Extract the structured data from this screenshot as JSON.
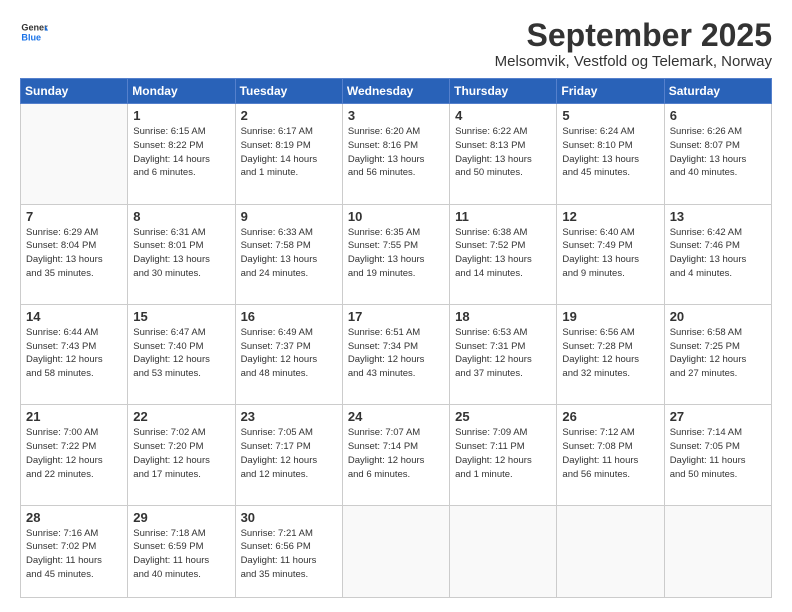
{
  "header": {
    "logo_line1": "General",
    "logo_line2": "Blue",
    "month": "September 2025",
    "location": "Melsomvik, Vestfold og Telemark, Norway"
  },
  "weekdays": [
    "Sunday",
    "Monday",
    "Tuesday",
    "Wednesday",
    "Thursday",
    "Friday",
    "Saturday"
  ],
  "weeks": [
    [
      {
        "day": "",
        "info": ""
      },
      {
        "day": "1",
        "info": "Sunrise: 6:15 AM\nSunset: 8:22 PM\nDaylight: 14 hours\nand 6 minutes."
      },
      {
        "day": "2",
        "info": "Sunrise: 6:17 AM\nSunset: 8:19 PM\nDaylight: 14 hours\nand 1 minute."
      },
      {
        "day": "3",
        "info": "Sunrise: 6:20 AM\nSunset: 8:16 PM\nDaylight: 13 hours\nand 56 minutes."
      },
      {
        "day": "4",
        "info": "Sunrise: 6:22 AM\nSunset: 8:13 PM\nDaylight: 13 hours\nand 50 minutes."
      },
      {
        "day": "5",
        "info": "Sunrise: 6:24 AM\nSunset: 8:10 PM\nDaylight: 13 hours\nand 45 minutes."
      },
      {
        "day": "6",
        "info": "Sunrise: 6:26 AM\nSunset: 8:07 PM\nDaylight: 13 hours\nand 40 minutes."
      }
    ],
    [
      {
        "day": "7",
        "info": "Sunrise: 6:29 AM\nSunset: 8:04 PM\nDaylight: 13 hours\nand 35 minutes."
      },
      {
        "day": "8",
        "info": "Sunrise: 6:31 AM\nSunset: 8:01 PM\nDaylight: 13 hours\nand 30 minutes."
      },
      {
        "day": "9",
        "info": "Sunrise: 6:33 AM\nSunset: 7:58 PM\nDaylight: 13 hours\nand 24 minutes."
      },
      {
        "day": "10",
        "info": "Sunrise: 6:35 AM\nSunset: 7:55 PM\nDaylight: 13 hours\nand 19 minutes."
      },
      {
        "day": "11",
        "info": "Sunrise: 6:38 AM\nSunset: 7:52 PM\nDaylight: 13 hours\nand 14 minutes."
      },
      {
        "day": "12",
        "info": "Sunrise: 6:40 AM\nSunset: 7:49 PM\nDaylight: 13 hours\nand 9 minutes."
      },
      {
        "day": "13",
        "info": "Sunrise: 6:42 AM\nSunset: 7:46 PM\nDaylight: 13 hours\nand 4 minutes."
      }
    ],
    [
      {
        "day": "14",
        "info": "Sunrise: 6:44 AM\nSunset: 7:43 PM\nDaylight: 12 hours\nand 58 minutes."
      },
      {
        "day": "15",
        "info": "Sunrise: 6:47 AM\nSunset: 7:40 PM\nDaylight: 12 hours\nand 53 minutes."
      },
      {
        "day": "16",
        "info": "Sunrise: 6:49 AM\nSunset: 7:37 PM\nDaylight: 12 hours\nand 48 minutes."
      },
      {
        "day": "17",
        "info": "Sunrise: 6:51 AM\nSunset: 7:34 PM\nDaylight: 12 hours\nand 43 minutes."
      },
      {
        "day": "18",
        "info": "Sunrise: 6:53 AM\nSunset: 7:31 PM\nDaylight: 12 hours\nand 37 minutes."
      },
      {
        "day": "19",
        "info": "Sunrise: 6:56 AM\nSunset: 7:28 PM\nDaylight: 12 hours\nand 32 minutes."
      },
      {
        "day": "20",
        "info": "Sunrise: 6:58 AM\nSunset: 7:25 PM\nDaylight: 12 hours\nand 27 minutes."
      }
    ],
    [
      {
        "day": "21",
        "info": "Sunrise: 7:00 AM\nSunset: 7:22 PM\nDaylight: 12 hours\nand 22 minutes."
      },
      {
        "day": "22",
        "info": "Sunrise: 7:02 AM\nSunset: 7:20 PM\nDaylight: 12 hours\nand 17 minutes."
      },
      {
        "day": "23",
        "info": "Sunrise: 7:05 AM\nSunset: 7:17 PM\nDaylight: 12 hours\nand 12 minutes."
      },
      {
        "day": "24",
        "info": "Sunrise: 7:07 AM\nSunset: 7:14 PM\nDaylight: 12 hours\nand 6 minutes."
      },
      {
        "day": "25",
        "info": "Sunrise: 7:09 AM\nSunset: 7:11 PM\nDaylight: 12 hours\nand 1 minute."
      },
      {
        "day": "26",
        "info": "Sunrise: 7:12 AM\nSunset: 7:08 PM\nDaylight: 11 hours\nand 56 minutes."
      },
      {
        "day": "27",
        "info": "Sunrise: 7:14 AM\nSunset: 7:05 PM\nDaylight: 11 hours\nand 50 minutes."
      }
    ],
    [
      {
        "day": "28",
        "info": "Sunrise: 7:16 AM\nSunset: 7:02 PM\nDaylight: 11 hours\nand 45 minutes."
      },
      {
        "day": "29",
        "info": "Sunrise: 7:18 AM\nSunset: 6:59 PM\nDaylight: 11 hours\nand 40 minutes."
      },
      {
        "day": "30",
        "info": "Sunrise: 7:21 AM\nSunset: 6:56 PM\nDaylight: 11 hours\nand 35 minutes."
      },
      {
        "day": "",
        "info": ""
      },
      {
        "day": "",
        "info": ""
      },
      {
        "day": "",
        "info": ""
      },
      {
        "day": "",
        "info": ""
      }
    ]
  ]
}
